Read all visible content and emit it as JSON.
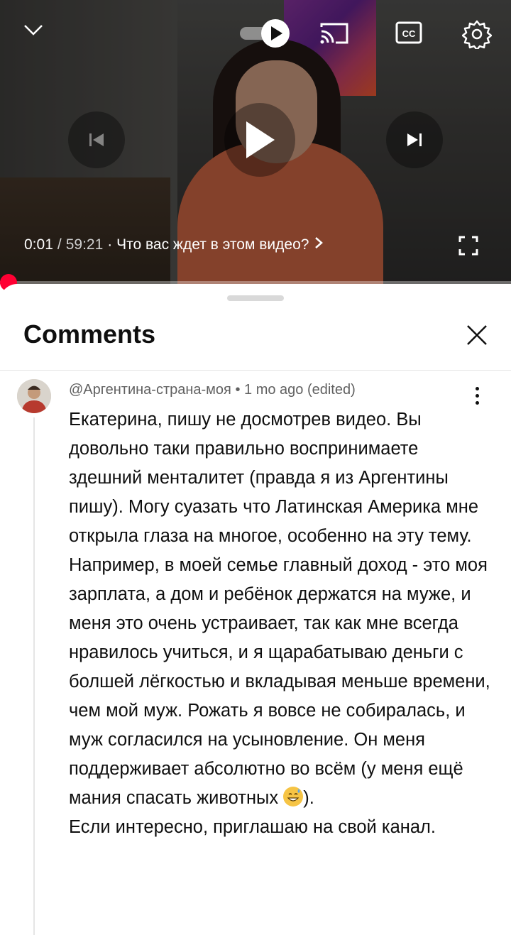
{
  "player": {
    "current_time": "0:01",
    "separator": "/",
    "duration": "59:21",
    "chapter": "· Что вас ждет в этом видео?",
    "progress_fraction": 0.0003,
    "icons": [
      "chevron-down-icon",
      "autoplay-toggle-icon",
      "cast-icon",
      "captions-icon",
      "settings-gear-icon",
      "previous-icon",
      "play-icon",
      "next-icon",
      "fullscreen-icon"
    ]
  },
  "comments_panel": {
    "title": "Comments",
    "close_icon": "close-icon"
  },
  "comment": {
    "author": "@Аргентина-страна-моя",
    "dot": " • ",
    "age": "1 mo ago (edited)",
    "text_before_emoji": "Екатерина, пишу не досмотрев видео. Вы довольно таки правильно воспринимаете здешний менталитет (правда я из Аргентины пишу). Могу суазать что Латинская Америка мне открыла глаза на многое, особенно на эту тему. Например, в моей семье главный доход - это моя зарплата, а дом и ребёнок держатся на муже, и меня это очень устраивает, так как мне всегда нравилось учиться, и я щарабатываю деньги с болшей лёгкостью и вкладывая меньше времени, чем мой муж. Рожать я вовсе не собиралась, и муж согласился на усыновление. Он меня поддерживает абсолютно во всём (у меня ещё мания спасать животных ",
    "emoji": "grinning-sweat-emoji",
    "text_after_emoji": ").\nЕсли интересно, приглашаю на свой канал."
  },
  "colors": {
    "progress": "#ff0033",
    "text_primary": "#0f0f0f",
    "text_secondary": "#606060"
  }
}
